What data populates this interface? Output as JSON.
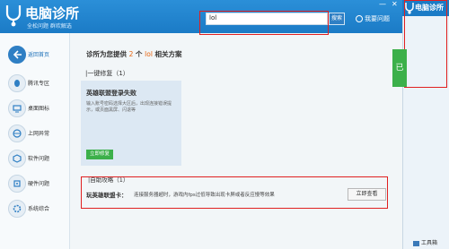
{
  "header": {
    "app_title": "电脑诊所",
    "slogan": "全松问题 群欢解选",
    "search_value": "lol",
    "search_button": "搜索",
    "feedback": "我要问题",
    "window_controls": [
      "—",
      "✕"
    ]
  },
  "right_window": {
    "title": "电脑诊所",
    "tab_label": "已",
    "toolbox": "工具箱"
  },
  "sidebar": {
    "items": [
      {
        "label": "返回首页",
        "icon": "back-arrow-icon"
      },
      {
        "label": "腾讯专区",
        "icon": "penguin-icon"
      },
      {
        "label": "桌面图标",
        "icon": "desktop-icon"
      },
      {
        "label": "上网异常",
        "icon": "globe-icon"
      },
      {
        "label": "软件问题",
        "icon": "app-icon"
      },
      {
        "label": "硬件问题",
        "icon": "hardware-icon"
      },
      {
        "label": "系统综合",
        "icon": "system-icon"
      }
    ]
  },
  "main": {
    "heading_prefix": "诊所为您提供",
    "heading_count": "2",
    "heading_mid": "个",
    "heading_keyword": "lol",
    "heading_suffix": "相关方案",
    "section1_title": "|一键修复（1）",
    "card": {
      "title": "英雄联盟登录失败",
      "description": "输入账号密码选择大区后，出现连接错误提示，或页面黑屏、闪退等",
      "button": "立即修复"
    },
    "section2_title": "|自助攻略（1）",
    "result": {
      "label": "玩英雄联盟卡：",
      "text": "连接服务器超时，游戏内fps过低导致出现卡屏或者反应慢等效果",
      "button": "立即查看"
    }
  },
  "colors": {
    "brand_blue": "#1b7bc6",
    "accent_orange": "#e8630e",
    "green": "#3cb04a",
    "annotation_red": "#e02020"
  }
}
